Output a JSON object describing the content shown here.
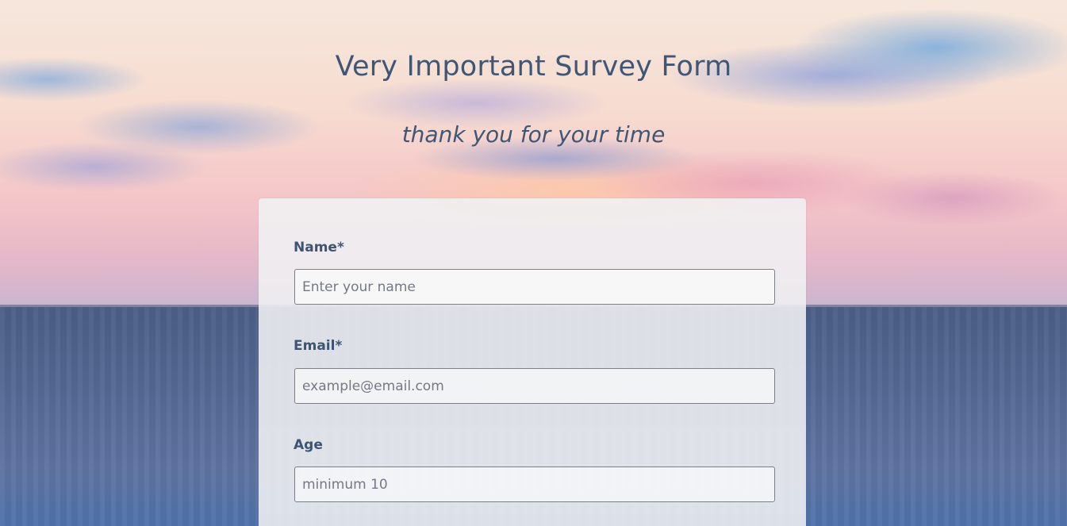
{
  "header": {
    "title": "Very Important Survey Form",
    "subtitle": "thank you for your time"
  },
  "form": {
    "fields": [
      {
        "label": "Name*",
        "placeholder": "Enter your name",
        "value": ""
      },
      {
        "label": "Email*",
        "placeholder": "example@email.com",
        "value": ""
      },
      {
        "label": "Age",
        "placeholder": "minimum 10",
        "value": ""
      }
    ]
  }
}
